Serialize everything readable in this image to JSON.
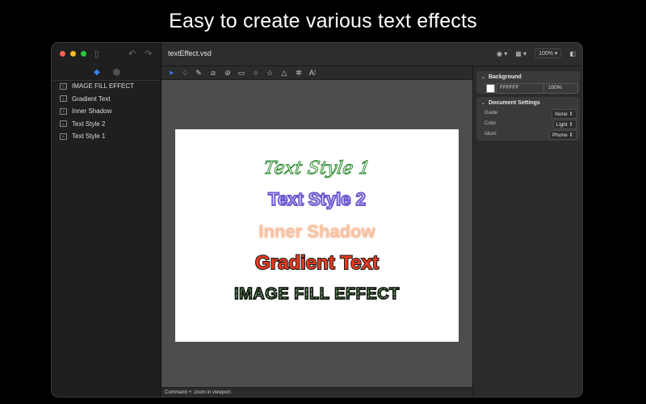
{
  "headline": "Easy to create various text effects",
  "window": {
    "document_title": "textEffect.vsd",
    "zoom": "100%"
  },
  "sidebar": {
    "layers": [
      {
        "label": "IMAGE FILL EFFECT"
      },
      {
        "label": "Gradient Text"
      },
      {
        "label": "Inner Shadow"
      },
      {
        "label": "Text Style 2"
      },
      {
        "label": "Text Style 1"
      }
    ]
  },
  "canvas": {
    "texts": {
      "style1": "Text Style 1",
      "style2": "Text Style 2",
      "inner_shadow": "Inner Shadow",
      "gradient": "Gradient Text",
      "image_fill": "IMAGE FILL EFFECT"
    }
  },
  "inspector": {
    "background": {
      "title": "Background",
      "hex": "FFFFFF",
      "opacity": "100%"
    },
    "document_settings": {
      "title": "Document Settings",
      "guide_label": "Guide",
      "guide_value": "None",
      "color_label": "Color",
      "color_value": "Light",
      "idiom_label": "Idiom",
      "idiom_value": "Phone"
    }
  },
  "statusbar": {
    "text": "Command +: zoom in viewport."
  },
  "colors": {
    "close": "#ff5f57",
    "minimize": "#febc2e",
    "maximize": "#28c840",
    "accent": "#3b82f6"
  }
}
